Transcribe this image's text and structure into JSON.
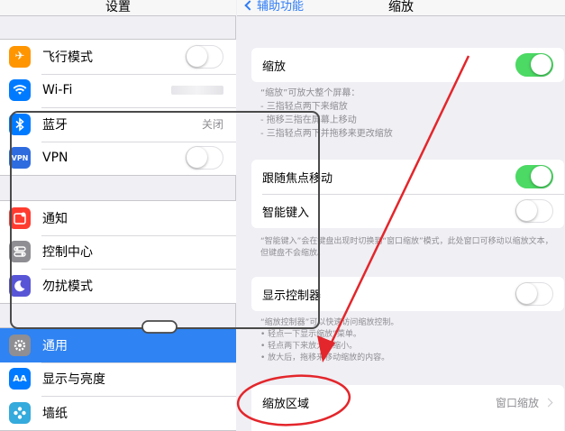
{
  "left_panel": {
    "title": "设置",
    "items": [
      {
        "label": "飞行模式",
        "icon": "airplane-icon",
        "color": "#ff9500"
      },
      {
        "label": "Wi-Fi",
        "icon": "wifi-icon",
        "color": "#007aff"
      },
      {
        "label": "蓝牙",
        "icon": "bluetooth-icon",
        "color": "#007aff",
        "value": "关闭"
      },
      {
        "label": "VPN",
        "icon": "vpn-icon",
        "color": "#2e6bdf"
      },
      {
        "label": "通知",
        "icon": "notifications-icon",
        "color": "#ff3b30"
      },
      {
        "label": "控制中心",
        "icon": "control-center-icon",
        "color": "#8e8e93"
      },
      {
        "label": "勿扰模式",
        "icon": "moon-icon",
        "color": "#5856d6"
      },
      {
        "label": "通用",
        "icon": "gear-icon",
        "color": "#8e8e93"
      },
      {
        "label": "显示与亮度",
        "icon": "display-icon",
        "color": "#007aff"
      },
      {
        "label": "墙纸",
        "icon": "wallpaper-icon",
        "color": "#35aadc"
      }
    ],
    "vpn_text": "VPN",
    "display_text": "AA"
  },
  "right_panel": {
    "back_label": "辅助功能",
    "title": "缩放",
    "zoom_label": "缩放",
    "zoom_desc": [
      "“缩放”可放大整个屏幕：",
      "- 三指轻点两下来缩放",
      "- 拖移三指在屏幕上移动",
      "- 三指轻点两下并拖移来更改缩放"
    ],
    "follow_focus_label": "跟随焦点移动",
    "smart_typing_label": "智能键入",
    "smart_typing_desc": "“智能键入”会在键盘出现时切换到“窗口缩放”模式，此处窗口可移动以缩放文本，但键盘不会缩放。",
    "show_controller_label": "显示控制器",
    "controller_desc": [
      "“缩放控制器”可以快速访问缩放控制。",
      "• 轻点一下显示缩放”菜单。",
      "• 轻点两下来放大和缩小。",
      "• 放大后，拖移来移动缩放的内容。"
    ],
    "zoom_region_label": "缩放区域",
    "zoom_region_value": "窗口缩放"
  },
  "toggles": {
    "airplane_on": false,
    "vpn_on": false,
    "zoom_on": true,
    "follow_focus_on": true,
    "smart_typing_on": false,
    "show_controller_on": false
  },
  "colors": {
    "accent_blue": "#2f7cf6",
    "selected_row": "#2f83f2",
    "switch_on": "#4cd964",
    "annotation_red": "#e3262b"
  }
}
